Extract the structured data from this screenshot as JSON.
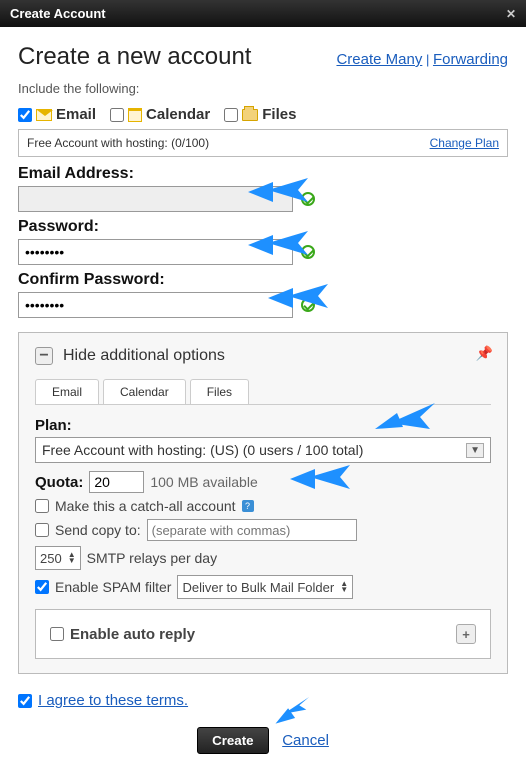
{
  "window": {
    "title": "Create Account"
  },
  "header": {
    "title": "Create a new account",
    "link_create_many": "Create Many",
    "link_forwarding": "Forwarding"
  },
  "include_label": "Include the following:",
  "types": {
    "email": "Email",
    "calendar": "Calendar",
    "files": "Files",
    "email_checked": true,
    "calendar_checked": false,
    "files_checked": false
  },
  "plan_bar": {
    "text": "Free Account with hosting: (0/100)",
    "change": "Change Plan"
  },
  "fields": {
    "email_label": "Email Address:",
    "email_value": "",
    "password_label": "Password:",
    "password_value": "•••••••••",
    "confirm_label": "Confirm Password:",
    "confirm_value": "•••••••••"
  },
  "options": {
    "header": "Hide additional options",
    "tabs": {
      "email": "Email",
      "calendar": "Calendar",
      "files": "Files"
    },
    "plan_label": "Plan:",
    "plan_value": "Free Account with hosting: (US) (0 users / 100 total)",
    "quota_label": "Quota:",
    "quota_value": "20",
    "quota_avail": "100 MB available",
    "catchall": "Make this a catch-all account",
    "sendcopy_label": "Send copy to:",
    "sendcopy_placeholder": "(separate with commas)",
    "smtp_value": "250",
    "smtp_label": "SMTP relays per day",
    "spam_label": "Enable SPAM filter",
    "spam_checked": true,
    "spam_action": "Deliver to Bulk Mail Folder",
    "autoreply": "Enable auto reply"
  },
  "terms": {
    "checked": true,
    "text": "I agree to these terms."
  },
  "actions": {
    "create": "Create",
    "cancel": "Cancel"
  }
}
